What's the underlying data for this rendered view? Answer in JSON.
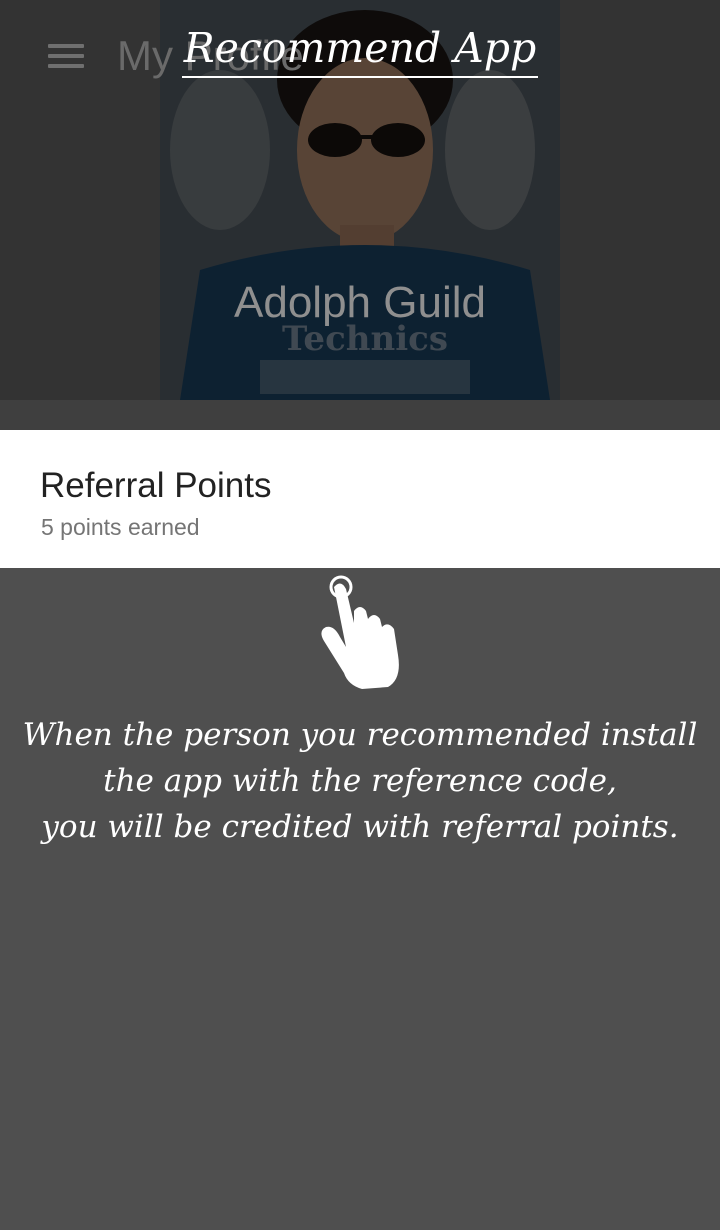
{
  "toolbar": {
    "title": "My Profile",
    "menu_icon": "hamburger-menu-icon"
  },
  "profile": {
    "name": "Adolph Guild"
  },
  "referral": {
    "title": "Referral Points",
    "subtitle": "5 points earned"
  },
  "overlay": {
    "title": "Recommend App",
    "hand_icon": "tap-hand-icon",
    "instruction_lines": [
      "When the person you recommended install",
      "the app with the reference code,",
      "you will be credited with referral points."
    ]
  },
  "colors": {
    "overlay_background": "#4f4f4f",
    "card_background": "#ffffff",
    "header_background": "#333333"
  }
}
